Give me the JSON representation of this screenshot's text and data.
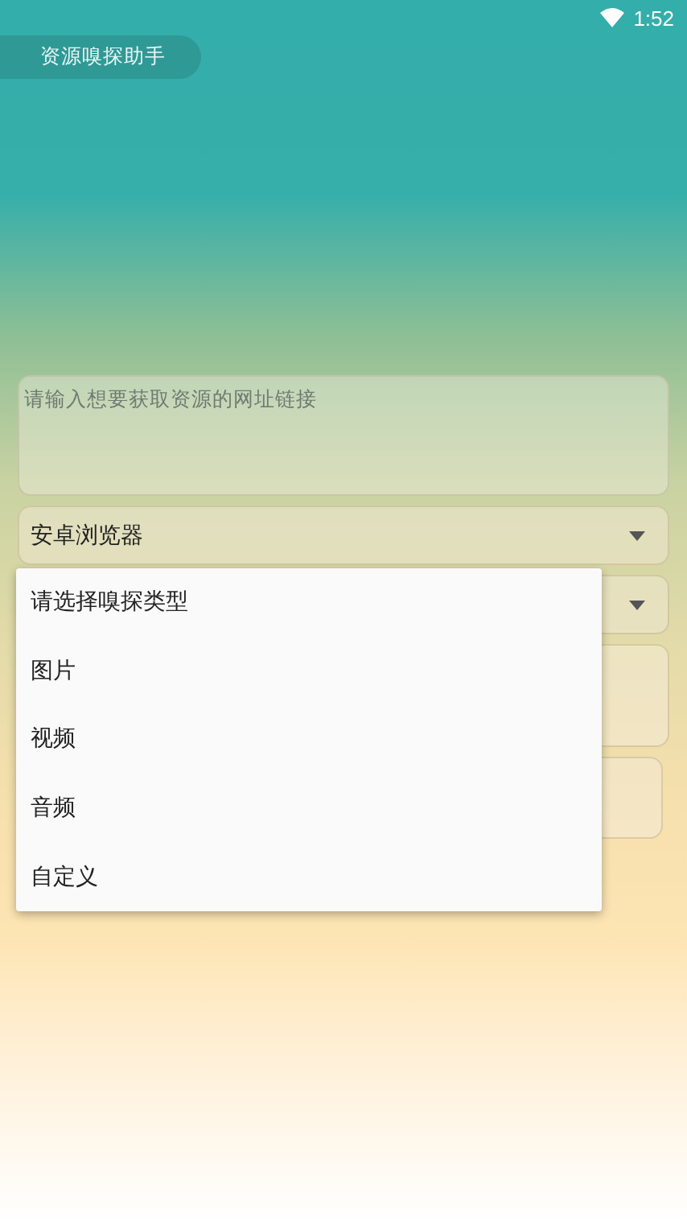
{
  "status_bar": {
    "time": "1:52"
  },
  "app_title": "资源嗅探助手",
  "url_field": {
    "placeholder": "请输入想要获取资源的网址链接"
  },
  "browser_select": {
    "value": "安卓浏览器"
  },
  "type_menu": {
    "items": [
      {
        "label": "请选择嗅探类型"
      },
      {
        "label": "图片"
      },
      {
        "label": "视频"
      },
      {
        "label": "音频"
      },
      {
        "label": "自定义"
      }
    ]
  }
}
